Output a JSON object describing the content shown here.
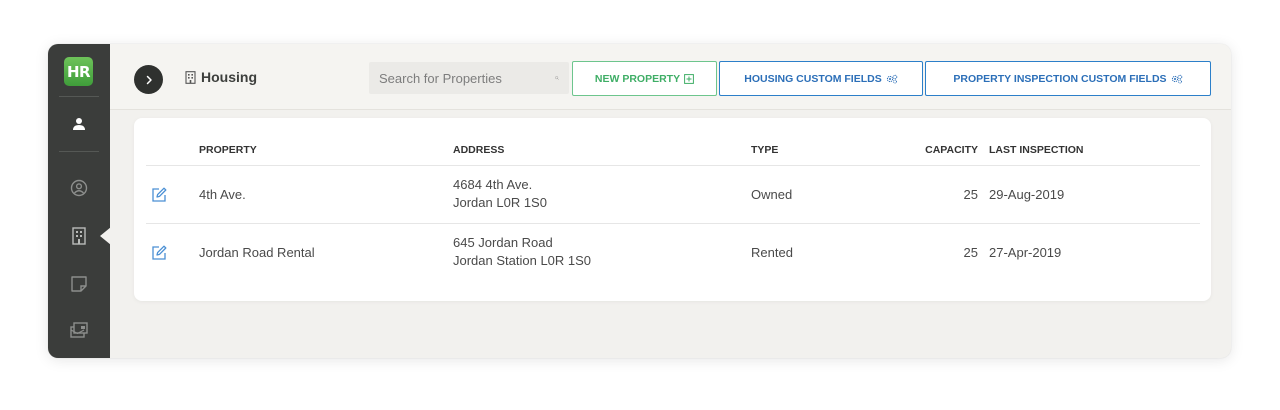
{
  "app": {
    "logo_text": "HR"
  },
  "sidebar": {
    "items": [
      {
        "icon": "user-icon",
        "active": false
      },
      {
        "icon": "profile-icon",
        "active": false
      },
      {
        "icon": "building-icon",
        "active": true
      },
      {
        "icon": "note-icon",
        "active": false
      },
      {
        "icon": "cards-icon",
        "active": false
      }
    ]
  },
  "header": {
    "section_title": "Housing",
    "search": {
      "placeholder": "Search for Properties",
      "value": ""
    },
    "buttons": {
      "new_property": "NEW PROPERTY",
      "housing_custom_fields": "HOUSING CUSTOM FIELDS",
      "inspection_custom_fields": "PROPERTY INSPECTION CUSTOM FIELDS"
    }
  },
  "table": {
    "columns": {
      "property": "PROPERTY",
      "address": "ADDRESS",
      "type": "TYPE",
      "capacity": "CAPACITY",
      "last_inspection": "LAST INSPECTION"
    },
    "rows": [
      {
        "property": "4th Ave.",
        "address_line1": "4684 4th Ave.",
        "address_line2": "Jordan  L0R 1S0",
        "type": "Owned",
        "capacity": "25",
        "last_inspection": "29-Aug-2019"
      },
      {
        "property": "Jordan Road Rental",
        "address_line1": "645 Jordan Road",
        "address_line2": "Jordan Station  L0R 1S0",
        "type": "Rented",
        "capacity": "25",
        "last_inspection": "27-Apr-2019"
      }
    ]
  },
  "colors": {
    "sidebar_bg": "#3b3d3b",
    "logo_green": "#4caf45",
    "accent_green": "#3fae66",
    "accent_blue": "#2c6fb8",
    "edit_icon_blue": "#4a8fd4"
  }
}
